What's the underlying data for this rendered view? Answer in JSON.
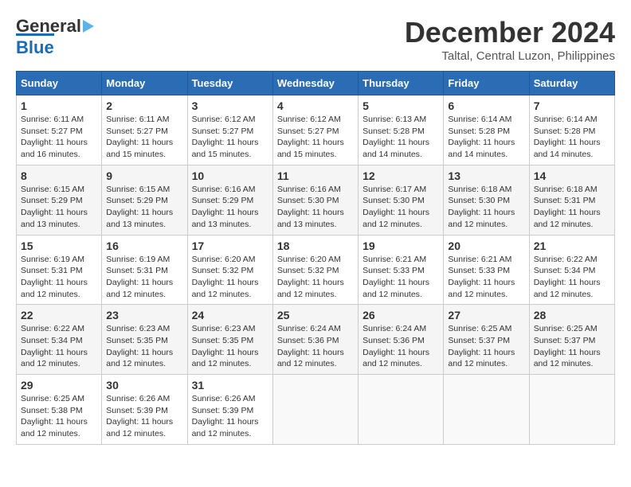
{
  "header": {
    "logo_general": "General",
    "logo_blue": "Blue",
    "month_title": "December 2024",
    "location": "Taltal, Central Luzon, Philippines"
  },
  "weekdays": [
    "Sunday",
    "Monday",
    "Tuesday",
    "Wednesday",
    "Thursday",
    "Friday",
    "Saturday"
  ],
  "weeks": [
    [
      {
        "day": "1",
        "sunrise": "6:11 AM",
        "sunset": "5:27 PM",
        "daylight": "11 hours and 16 minutes."
      },
      {
        "day": "2",
        "sunrise": "6:11 AM",
        "sunset": "5:27 PM",
        "daylight": "11 hours and 15 minutes."
      },
      {
        "day": "3",
        "sunrise": "6:12 AM",
        "sunset": "5:27 PM",
        "daylight": "11 hours and 15 minutes."
      },
      {
        "day": "4",
        "sunrise": "6:12 AM",
        "sunset": "5:27 PM",
        "daylight": "11 hours and 15 minutes."
      },
      {
        "day": "5",
        "sunrise": "6:13 AM",
        "sunset": "5:28 PM",
        "daylight": "11 hours and 14 minutes."
      },
      {
        "day": "6",
        "sunrise": "6:14 AM",
        "sunset": "5:28 PM",
        "daylight": "11 hours and 14 minutes."
      },
      {
        "day": "7",
        "sunrise": "6:14 AM",
        "sunset": "5:28 PM",
        "daylight": "11 hours and 14 minutes."
      }
    ],
    [
      {
        "day": "8",
        "sunrise": "6:15 AM",
        "sunset": "5:29 PM",
        "daylight": "11 hours and 13 minutes."
      },
      {
        "day": "9",
        "sunrise": "6:15 AM",
        "sunset": "5:29 PM",
        "daylight": "11 hours and 13 minutes."
      },
      {
        "day": "10",
        "sunrise": "6:16 AM",
        "sunset": "5:29 PM",
        "daylight": "11 hours and 13 minutes."
      },
      {
        "day": "11",
        "sunrise": "6:16 AM",
        "sunset": "5:30 PM",
        "daylight": "11 hours and 13 minutes."
      },
      {
        "day": "12",
        "sunrise": "6:17 AM",
        "sunset": "5:30 PM",
        "daylight": "11 hours and 12 minutes."
      },
      {
        "day": "13",
        "sunrise": "6:18 AM",
        "sunset": "5:30 PM",
        "daylight": "11 hours and 12 minutes."
      },
      {
        "day": "14",
        "sunrise": "6:18 AM",
        "sunset": "5:31 PM",
        "daylight": "11 hours and 12 minutes."
      }
    ],
    [
      {
        "day": "15",
        "sunrise": "6:19 AM",
        "sunset": "5:31 PM",
        "daylight": "11 hours and 12 minutes."
      },
      {
        "day": "16",
        "sunrise": "6:19 AM",
        "sunset": "5:31 PM",
        "daylight": "11 hours and 12 minutes."
      },
      {
        "day": "17",
        "sunrise": "6:20 AM",
        "sunset": "5:32 PM",
        "daylight": "11 hours and 12 minutes."
      },
      {
        "day": "18",
        "sunrise": "6:20 AM",
        "sunset": "5:32 PM",
        "daylight": "11 hours and 12 minutes."
      },
      {
        "day": "19",
        "sunrise": "6:21 AM",
        "sunset": "5:33 PM",
        "daylight": "11 hours and 12 minutes."
      },
      {
        "day": "20",
        "sunrise": "6:21 AM",
        "sunset": "5:33 PM",
        "daylight": "11 hours and 12 minutes."
      },
      {
        "day": "21",
        "sunrise": "6:22 AM",
        "sunset": "5:34 PM",
        "daylight": "11 hours and 12 minutes."
      }
    ],
    [
      {
        "day": "22",
        "sunrise": "6:22 AM",
        "sunset": "5:34 PM",
        "daylight": "11 hours and 12 minutes."
      },
      {
        "day": "23",
        "sunrise": "6:23 AM",
        "sunset": "5:35 PM",
        "daylight": "11 hours and 12 minutes."
      },
      {
        "day": "24",
        "sunrise": "6:23 AM",
        "sunset": "5:35 PM",
        "daylight": "11 hours and 12 minutes."
      },
      {
        "day": "25",
        "sunrise": "6:24 AM",
        "sunset": "5:36 PM",
        "daylight": "11 hours and 12 minutes."
      },
      {
        "day": "26",
        "sunrise": "6:24 AM",
        "sunset": "5:36 PM",
        "daylight": "11 hours and 12 minutes."
      },
      {
        "day": "27",
        "sunrise": "6:25 AM",
        "sunset": "5:37 PM",
        "daylight": "11 hours and 12 minutes."
      },
      {
        "day": "28",
        "sunrise": "6:25 AM",
        "sunset": "5:37 PM",
        "daylight": "11 hours and 12 minutes."
      }
    ],
    [
      {
        "day": "29",
        "sunrise": "6:25 AM",
        "sunset": "5:38 PM",
        "daylight": "11 hours and 12 minutes."
      },
      {
        "day": "30",
        "sunrise": "6:26 AM",
        "sunset": "5:39 PM",
        "daylight": "11 hours and 12 minutes."
      },
      {
        "day": "31",
        "sunrise": "6:26 AM",
        "sunset": "5:39 PM",
        "daylight": "11 hours and 12 minutes."
      },
      null,
      null,
      null,
      null
    ]
  ],
  "labels": {
    "sunrise": "Sunrise:",
    "sunset": "Sunset:",
    "daylight": "Daylight:"
  }
}
